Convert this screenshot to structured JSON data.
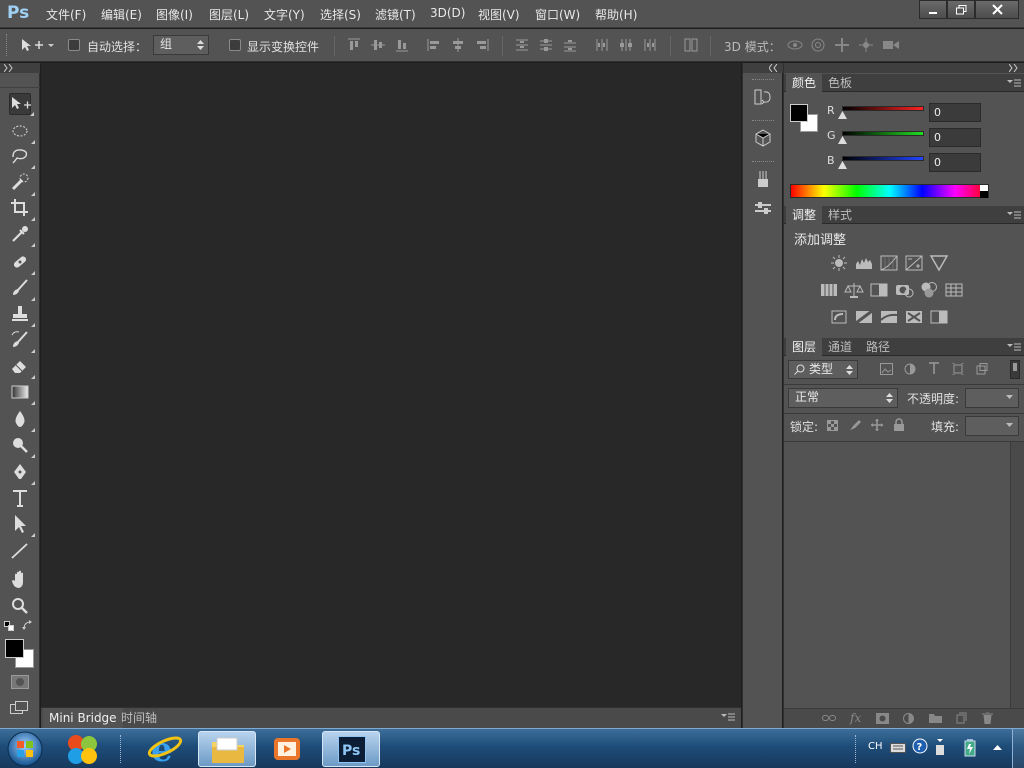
{
  "app": {
    "logo": "Ps"
  },
  "menubar": {
    "items": [
      "文件(F)",
      "编辑(E)",
      "图像(I)",
      "图层(L)",
      "文字(Y)",
      "选择(S)",
      "滤镜(T)",
      "3D(D)",
      "视图(V)",
      "窗口(W)",
      "帮助(H)"
    ]
  },
  "window_controls": {
    "minimize": "minimize-icon",
    "restore": "restore-icon",
    "close": "close-icon"
  },
  "options_bar": {
    "auto_select_label": "自动选择：",
    "auto_select_value": "组",
    "show_transform_label": "显示变换控件",
    "mode_3d_label": "3D 模式："
  },
  "tools": [
    "move-tool-icon",
    "marquee-tool-icon",
    "lasso-tool-icon",
    "quick-select-tool-icon",
    "crop-tool-icon",
    "eyedropper-tool-icon",
    "healing-brush-tool-icon",
    "brush-tool-icon",
    "clone-stamp-tool-icon",
    "history-brush-tool-icon",
    "eraser-tool-icon",
    "gradient-tool-icon",
    "blur-tool-icon",
    "dodge-tool-icon",
    "pen-tool-icon",
    "type-tool-icon",
    "path-select-tool-icon",
    "line-tool-icon",
    "hand-tool-icon",
    "zoom-tool-icon"
  ],
  "colors": {
    "foreground": "#000000",
    "background": "#ffffff",
    "accent": "#9fd0f5"
  },
  "bottom_tabs": [
    "Mini Bridge",
    "时间轴"
  ],
  "color_panel": {
    "tabs": [
      "颜色",
      "色板"
    ],
    "channels": [
      {
        "label": "R",
        "value": "0",
        "color": "#ff2222"
      },
      {
        "label": "G",
        "value": "0",
        "color": "#22dd22"
      },
      {
        "label": "B",
        "value": "0",
        "color": "#2244ff"
      }
    ]
  },
  "adjust_panel": {
    "tabs": [
      "调整",
      "样式"
    ],
    "title": "添加调整"
  },
  "layers_panel": {
    "tabs": [
      "图层",
      "通道",
      "路径"
    ],
    "filter_value": "类型",
    "blend_mode": "正常",
    "opacity_label": "不透明度:",
    "lock_label": "锁定:",
    "fill_label": "填充:"
  },
  "taskbar": {
    "tray_lang": "CH",
    "apps": [
      "start-orb-icon",
      "windows-logo-icon",
      "internet-explorer-icon",
      "file-explorer-icon",
      "media-player-icon",
      "photoshop-icon"
    ]
  }
}
